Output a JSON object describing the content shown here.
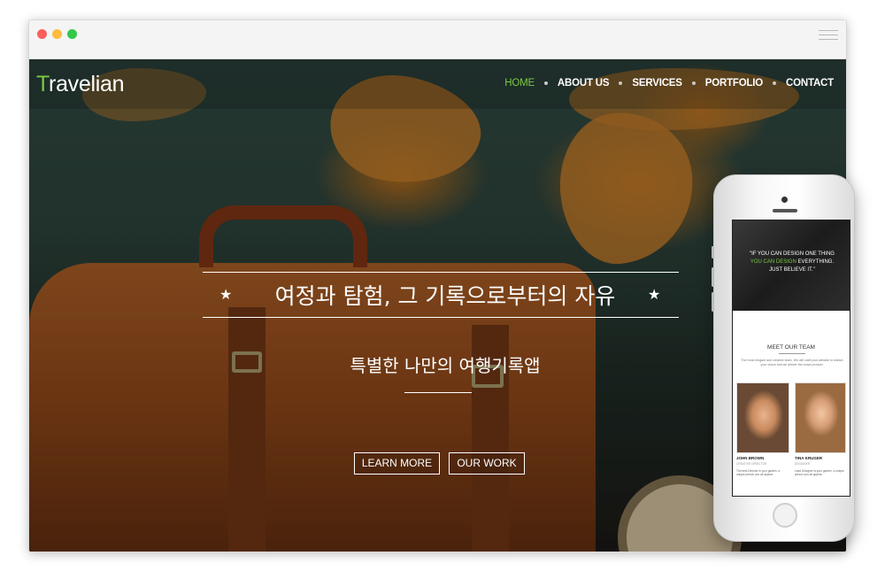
{
  "site": {
    "logo_first": "T",
    "logo_rest": "ravelian"
  },
  "nav": {
    "items": [
      {
        "label": "HOME",
        "active": true
      },
      {
        "label": "ABOUT US",
        "active": false
      },
      {
        "label": "SERVICES",
        "active": false
      },
      {
        "label": "PORTFOLIO",
        "active": false
      },
      {
        "label": "CONTACT",
        "active": false
      }
    ]
  },
  "hero": {
    "title": "여정과 탐험, 그 기록으로부터의 자유",
    "subtitle": "특별한 나만의 여행기록앱",
    "buttons": {
      "learn_more": "LEARN MORE",
      "our_work": "OUR WORK"
    }
  },
  "mobile": {
    "quote_line1": "\"IF YOU CAN DESIGN ONE THING",
    "quote_line2_highlight": "YOU CAN DESIGN",
    "quote_line2_rest": " EVERYTHING.",
    "quote_line3": "JUST BELIEVE IT.\"",
    "team_title": "MEET OUR TEAM",
    "team_desc": "The most elegant and creative team. We will craft your website to realize your vision and we deliver the exact product.",
    "members": [
      {
        "name": "JOHN BROWN",
        "role": "CREATIVE DIRECTOR",
        "bio": "The best Director in your garden, a unique person you all appear."
      },
      {
        "name": "TINA KRUGER",
        "role": "DESIGNER",
        "bio": "Lead Designer is your garden, a unique person you all appear."
      }
    ]
  },
  "colors": {
    "accent": "#7ac943",
    "nav_text": "#ffffff"
  }
}
